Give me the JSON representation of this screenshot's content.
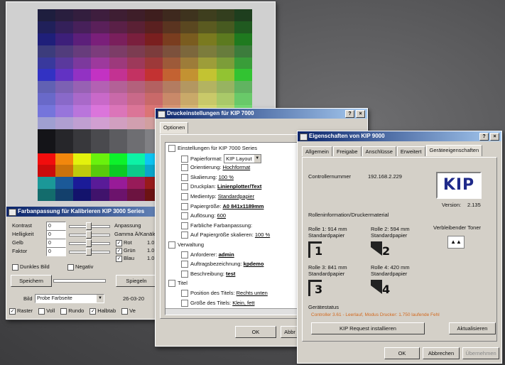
{
  "back_window": {
    "title": "Farbanpassung für Kalibrieren KIP 3000 Series",
    "controls": [
      {
        "label": "Kontrast",
        "value": "0"
      },
      {
        "label": "Helligkeit",
        "value": "0"
      },
      {
        "label": "Gelb",
        "value": "0"
      },
      {
        "label": "Faktor",
        "value": "0"
      }
    ],
    "adjust_label": "Anpassung",
    "gamma_label": "Gamma Ä/Kanäle",
    "channels": [
      {
        "label": "Rot",
        "value": "1.0"
      },
      {
        "label": "Grün",
        "value": "1.0"
      },
      {
        "label": "Blau",
        "value": "1.0"
      }
    ],
    "dunkles_bild": "Dunkles Bild",
    "negativ": "Negativ",
    "speichern": "Speichern",
    "spiegeln": "Spiegeln",
    "bild_label": "Bild",
    "bild_select": "Probe Farbseite",
    "date": "26-03-20",
    "checks": [
      "Raster",
      "Voll",
      "Rundo",
      "Halbtab",
      "Ve"
    ]
  },
  "mid_window": {
    "title": "Druckeinstellungen für KIP 7000",
    "tab": "Optionen",
    "tree": [
      {
        "text": "Einstellungen für KIP 7000 Series",
        "value": "",
        "level": 0,
        "icon": "printer-icon"
      },
      {
        "text": "Papierformat:",
        "value": "KIP Layout",
        "level": 1,
        "icon": "doc-icon"
      },
      {
        "text": "Orientierung:",
        "value": "Hochformat",
        "level": 1,
        "icon": "doc-icon"
      },
      {
        "text": "Skalierung:",
        "value": "100 %",
        "level": 1,
        "icon": "doc-icon"
      },
      {
        "text": "Druckplan:",
        "value": "Linienplotter/Text",
        "level": 1,
        "icon": "doc-icon"
      },
      {
        "text": "Medientyp:",
        "value": "Standardpapier",
        "level": 1,
        "icon": "doc-icon"
      },
      {
        "text": "Papiergröße:",
        "value": "A0 841x1189mm",
        "level": 1,
        "icon": "doc-icon"
      },
      {
        "text": "Auflösung:",
        "value": "600",
        "level": 1,
        "icon": "doc-icon"
      },
      {
        "text": "Farbliche Farbanpassung:",
        "value": "",
        "level": 1,
        "icon": "doc-icon"
      },
      {
        "text": "Auf Papiergröße skalieren:",
        "value": "100 %",
        "level": 1,
        "icon": "doc-icon"
      },
      {
        "text": "Verwaltung",
        "value": "",
        "level": 0,
        "icon": "folder-icon"
      },
      {
        "text": "Anforderer:",
        "value": "admin",
        "level": 1,
        "icon": "doc-icon"
      },
      {
        "text": "Auftragsbezeichnung:",
        "value": "kpdemo",
        "level": 1,
        "icon": "doc-icon"
      },
      {
        "text": "Beschreibung:",
        "value": "test",
        "level": 1,
        "icon": "doc-icon"
      },
      {
        "text": "Titel",
        "value": "",
        "level": 0,
        "icon": "folder-icon"
      },
      {
        "text": "Position des Titels:",
        "value": "Rechts unten",
        "level": 1,
        "icon": "doc-icon"
      },
      {
        "text": "Größe des Titels:",
        "value": "Klein, fett",
        "level": 1,
        "icon": "doc-icon"
      }
    ],
    "ok": "OK",
    "cancel": "Abbr"
  },
  "front_window": {
    "title": "Eigenschaften von KIP 9000",
    "tabs": [
      "Allgemein",
      "Freigabe",
      "Anschlüsse",
      "Erweitert",
      "Geräteeigenschaften"
    ],
    "controller_label": "Controllernummer",
    "controller_value": "192.168.2.229",
    "logo": "KIP",
    "version_label": "Version:",
    "version_value": "2.135",
    "rolls_label": "Rolleninformation/Druckermaterial",
    "rolls": [
      {
        "line1": "Rolle 1: 914 mm",
        "line2": "Standardpapier",
        "num": "1"
      },
      {
        "line1": "Rolle 2: 594 mm",
        "line2": "Standardpapier",
        "num": "2"
      },
      {
        "line1": "Rolle 3: 841 mm",
        "line2": "Standardpapier",
        "num": "3"
      },
      {
        "line1": "Rolle 4: 420 mm",
        "line2": "Standardpapier",
        "num": "4"
      }
    ],
    "toner_label": "Verbleibender Toner",
    "status_label": "Gerätestatus",
    "status_text": "Controller 3.61 - Leerlauf, Modus Drucker: 1.750 laufende Fehl",
    "install_btn": "KIP Request installieren",
    "refresh_btn": "Aktualisieren",
    "ok": "OK",
    "cancel": "Abbrechen",
    "apply": "Übernehmen"
  },
  "colors": {
    "titlebar_start": "#0a246a",
    "titlebar_end": "#a6caf0",
    "dialog_bg": "#d4d0c8",
    "kip_logo": "#1f2a8a",
    "status_orange": "#d2691e"
  }
}
